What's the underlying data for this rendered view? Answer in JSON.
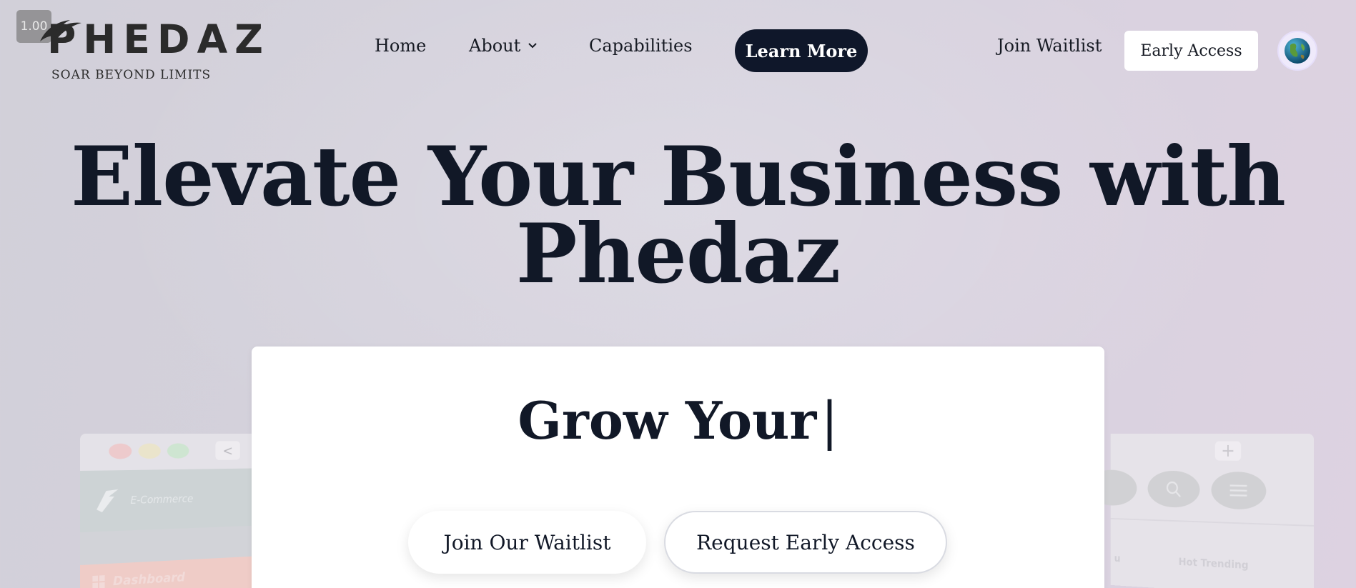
{
  "zoom_badge": "1.00",
  "brand": {
    "name": "PHEDAZ",
    "tagline": "SOAR BEYOND LIMITS"
  },
  "nav": {
    "home": "Home",
    "about": "About",
    "capabilities": "Capabilities",
    "learn_more": "Learn More",
    "join_waitlist": "Join Waitlist",
    "early_access": "Early Access",
    "globe_icon": "globe-icon"
  },
  "hero": {
    "title": "Elevate Your Business with Phedaz",
    "typing_text": "Grow Your",
    "caret": "|"
  },
  "cta": {
    "waitlist": "Join Our Waitlist",
    "early_access": "Request Early Access"
  },
  "mock_left": {
    "ecommerce": "E-Commerce",
    "dashboard": "Dashboard",
    "back": "<"
  },
  "mock_right": {
    "plus": "+",
    "hot_trending": "Hot Trending",
    "partial": "u"
  },
  "colors": {
    "primary_dark": "#0f172a",
    "text": "#111827",
    "background": "#d4d1dc",
    "white": "#ffffff"
  }
}
